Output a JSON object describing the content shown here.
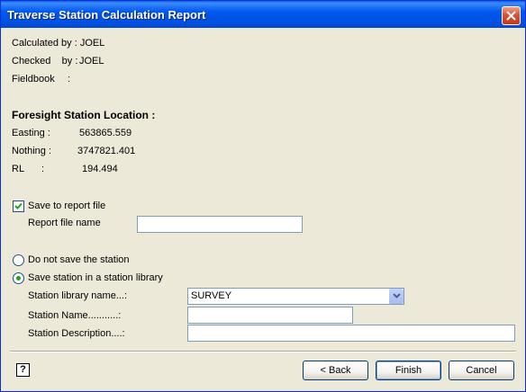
{
  "window": {
    "title": "Traverse Station Calculation Report"
  },
  "info": {
    "calculated_by": "Calculated by : JOEL",
    "checked_by_label": "Checked    by :",
    "checked_by_value": "JOEL",
    "fieldbook_label": "Fieldbook",
    "fieldbook_sep": ":"
  },
  "foresight": {
    "heading": "Foresight Station Location :",
    "easting_label": "Easting :",
    "easting_value": "563865.559",
    "northing_label": "Nothing :",
    "northing_value": "3747821.401",
    "rl_label": "RL",
    "rl_sep": ":",
    "rl_value": "194.494"
  },
  "report": {
    "save_to_report_label": "Save to report file",
    "save_to_report_checked": true,
    "report_file_name_label": "Report file name",
    "report_file_name_value": ""
  },
  "station_options": {
    "do_not_save_label": "Do not save the station",
    "save_in_library_label": "Save station in a station library",
    "selected": "save_in_library"
  },
  "library": {
    "library_name_label": "Station library name...:",
    "library_name_value": "SURVEY",
    "station_name_label": "Station Name...........:",
    "station_name_value": "",
    "station_description_label": "Station Description....:",
    "station_description_value": ""
  },
  "footer": {
    "help_icon": "?",
    "back_label": "< Back",
    "finish_label": "Finish",
    "cancel_label": "Cancel"
  },
  "colors": {
    "titlebar": "#0054E3",
    "dialog_bg": "#ECE9D8",
    "close_button": "#D85436",
    "radio_dot": "#21A121"
  }
}
